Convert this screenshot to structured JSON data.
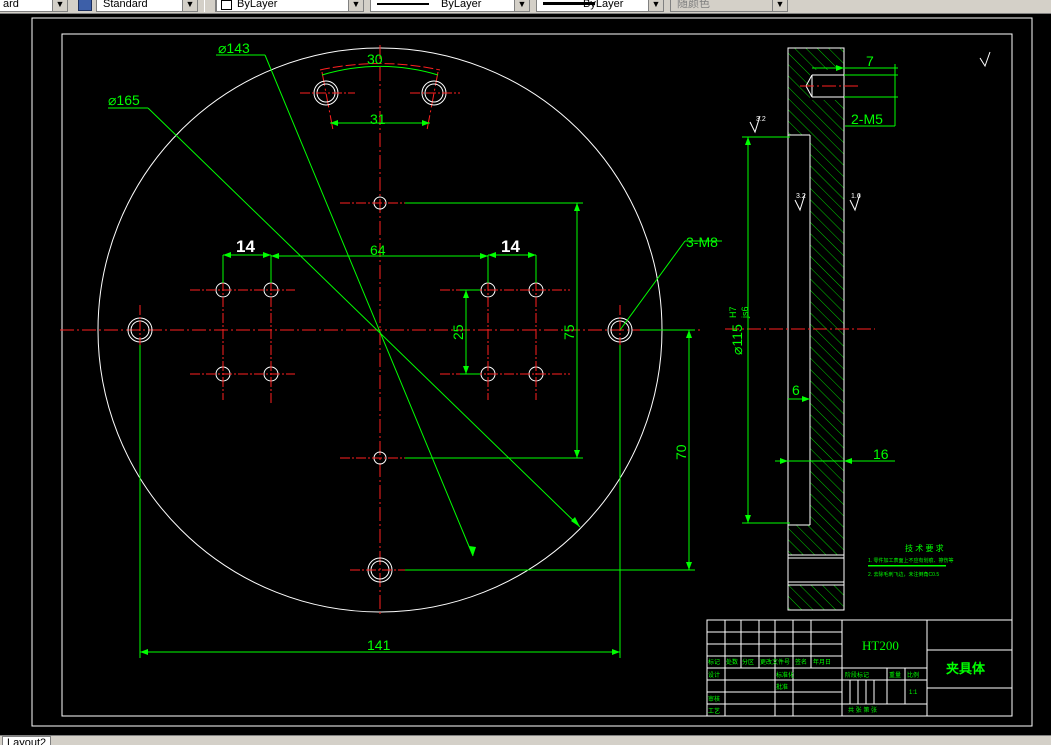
{
  "toolbar": {
    "text_style": "ard",
    "dim_style": "Standard",
    "layer": "ByLayer",
    "linetype": "ByLayer",
    "lineweight": "ByLayer",
    "plot_style": "随颜色"
  },
  "drawing": {
    "dims": {
      "d143": "⌀143",
      "d165": "⌀165",
      "d30": "30",
      "d31": "31",
      "d14a": "14",
      "d14b": "14",
      "d64": "64",
      "d3m8": "3-M8",
      "d25": "25",
      "d75": "75",
      "d70": "70",
      "d141": "141",
      "d7": "7",
      "d2m5": "2-M5",
      "d115": "⌀115",
      "d115fit_top": "H7",
      "d115fit_bot": "js6",
      "d6": "6",
      "d16": "16"
    },
    "roughness": {
      "r1": "3.2",
      "r2": "3.2",
      "r3": "1.6"
    },
    "notes": {
      "title": "技 术 要 求",
      "line1": "1. 零件加工表面上不应有划痕、擦伤等",
      "line2": "2. 去除毛刺飞边，未注倒角C0.5"
    },
    "title_block": {
      "material": "HT200",
      "part_name": "夹具体",
      "h_mark": "标记",
      "h_count": "处数",
      "h_zone": "分区",
      "h_docno": "更改文件号",
      "h_sign": "签名",
      "h_date": "年月日",
      "r_design": "设计",
      "r_std": "标准化",
      "r_check": "审核",
      "r_approve": "批准",
      "r_proc": "工艺",
      "stage": "阶段标记",
      "weight": "重量",
      "scale": "比例",
      "scale_val": "1:1",
      "sheet": "共  张  第  张"
    }
  },
  "layout_tab": {
    "label": "Layout2"
  }
}
